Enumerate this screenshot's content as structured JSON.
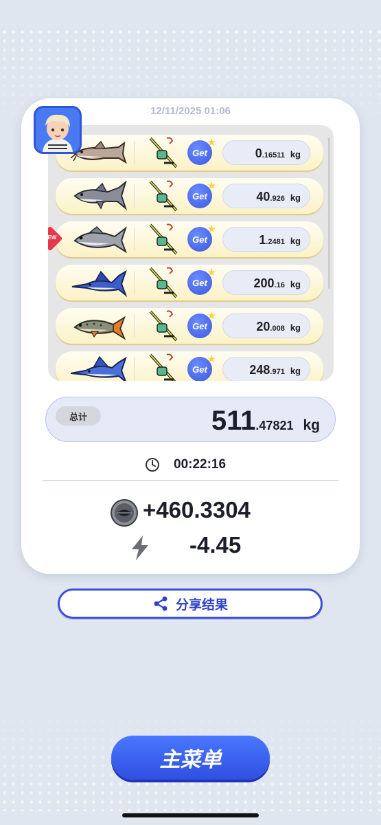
{
  "timestamp": "12/11/2025 01:06",
  "fish_list": [
    {
      "fish": "catfish-icon",
      "weight_int": "0",
      "weight_dec": ".16511",
      "unit": "kg",
      "new": false,
      "get_label": "Get"
    },
    {
      "fish": "shark-icon",
      "weight_int": "40",
      "weight_dec": ".926",
      "unit": "kg",
      "new": false,
      "get_label": "Get"
    },
    {
      "fish": "grey-fish-icon",
      "weight_int": "1",
      "weight_dec": ".2481",
      "unit": "kg",
      "new": true,
      "new_label": "NEW",
      "get_label": "Get"
    },
    {
      "fish": "marlin-icon",
      "weight_int": "200",
      "weight_dec": ".16",
      "unit": "kg",
      "new": false,
      "get_label": "Get"
    },
    {
      "fish": "trout-icon",
      "weight_int": "20",
      "weight_dec": ".008",
      "unit": "kg",
      "new": false,
      "get_label": "Get"
    },
    {
      "fish": "swordfish-icon",
      "weight_int": "248",
      "weight_dec": ".971",
      "unit": "kg",
      "new": false,
      "get_label": "Get"
    }
  ],
  "total": {
    "label": "总计",
    "int": "511",
    "dec": ".47821",
    "unit": "kg"
  },
  "duration": "00:22:16",
  "coin_delta": "+460.3304",
  "energy_delta": "-4.45",
  "share_label": "分享结果",
  "main_menu_label": "主菜单",
  "colors": {
    "accent": "#3d4fd8",
    "badge_new": "#e8364a",
    "card_bg": "#ffffff",
    "page_bg": "#dfe6ef"
  }
}
